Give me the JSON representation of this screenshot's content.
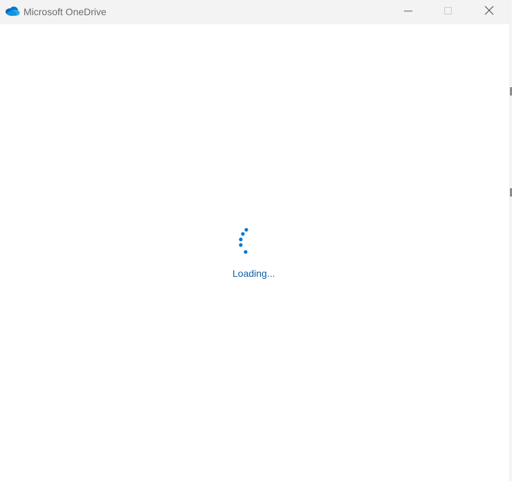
{
  "window": {
    "title": "Microsoft OneDrive",
    "app_icon": "onedrive-cloud-icon",
    "controls": {
      "minimize_icon": "minimize-icon",
      "maximize_icon": "maximize-icon",
      "close_icon": "close-icon"
    }
  },
  "main": {
    "spinner_icon": "loading-spinner-icon",
    "status_text": "Loading..."
  },
  "colors": {
    "accent": "#0078d4",
    "status_text": "#0f5ea8",
    "titlebar_bg": "#f3f3f3",
    "content_bg": "#ffffff"
  }
}
